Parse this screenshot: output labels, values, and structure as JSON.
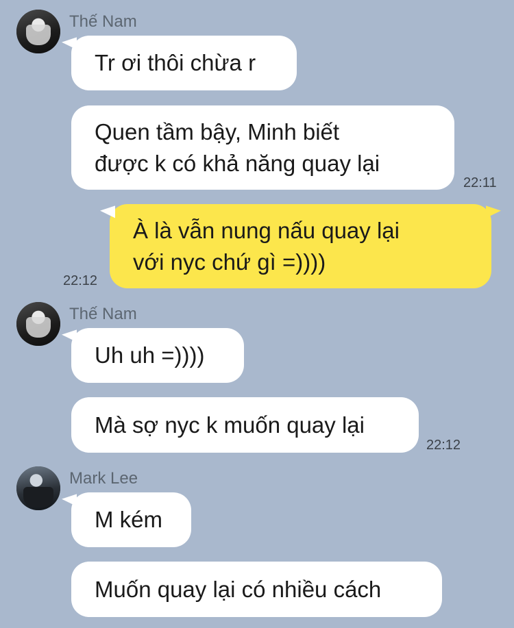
{
  "messages": [
    {
      "sender": "Thế Nam",
      "text": "Tr ơi thôi chừa r"
    },
    {
      "text_line1": "Quen tầm bậy, Minh biết",
      "text_line2": "được k có khả năng quay lại",
      "time": "22:11"
    },
    {
      "text_line1": "À là vẫn nung nấu quay lại",
      "text_line2": "với nyc chứ gì =))))",
      "time": "22:12"
    },
    {
      "sender": "Thế Nam",
      "text": "Uh uh =))))"
    },
    {
      "text": "Mà sợ nyc k muốn quay lại",
      "time": "22:12"
    },
    {
      "sender": "Mark Lee",
      "text": "M kém"
    },
    {
      "text": "Muốn quay lại có nhiều cách"
    }
  ]
}
